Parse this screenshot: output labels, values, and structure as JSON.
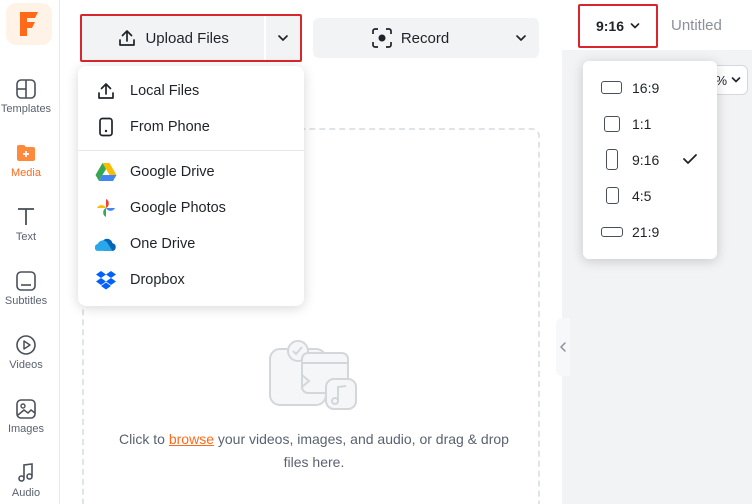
{
  "sidebar": {
    "logo": "F",
    "items": [
      {
        "label": "Templates",
        "icon": "templates-icon"
      },
      {
        "label": "Media",
        "icon": "media-folder-icon",
        "active": true
      },
      {
        "label": "Text",
        "icon": "text-icon"
      },
      {
        "label": "Subtitles",
        "icon": "subtitles-icon"
      },
      {
        "label": "Videos",
        "icon": "video-play-icon"
      },
      {
        "label": "Images",
        "icon": "image-icon"
      },
      {
        "label": "Audio",
        "icon": "music-note-icon"
      }
    ]
  },
  "toolbar": {
    "upload_label": "Upload Files",
    "record_label": "Record"
  },
  "upload_menu": {
    "items": [
      {
        "label": "Local Files",
        "icon": "upload-icon"
      },
      {
        "label": "From Phone",
        "icon": "phone-icon"
      },
      {
        "label": "Google Drive",
        "icon": "google-drive-icon"
      },
      {
        "label": "Google Photos",
        "icon": "google-photos-icon"
      },
      {
        "label": "One Drive",
        "icon": "onedrive-icon"
      },
      {
        "label": "Dropbox",
        "icon": "dropbox-icon"
      }
    ]
  },
  "dropzone": {
    "text_before": "Click to ",
    "link": "browse",
    "text_after": " your videos, images, and audio, or drag & drop files here."
  },
  "project": {
    "aspect_ratio": "9:16",
    "title": "Untitled",
    "zoom_visible_text": "%"
  },
  "ratio_menu": {
    "items": [
      {
        "label": "16:9",
        "selected": false
      },
      {
        "label": "1:1",
        "selected": false
      },
      {
        "label": "9:16",
        "selected": true
      },
      {
        "label": "4:5",
        "selected": false
      },
      {
        "label": "21:9",
        "selected": false
      }
    ]
  },
  "colors": {
    "accent": "#ff6a1a",
    "highlight_border": "#d9262c"
  }
}
